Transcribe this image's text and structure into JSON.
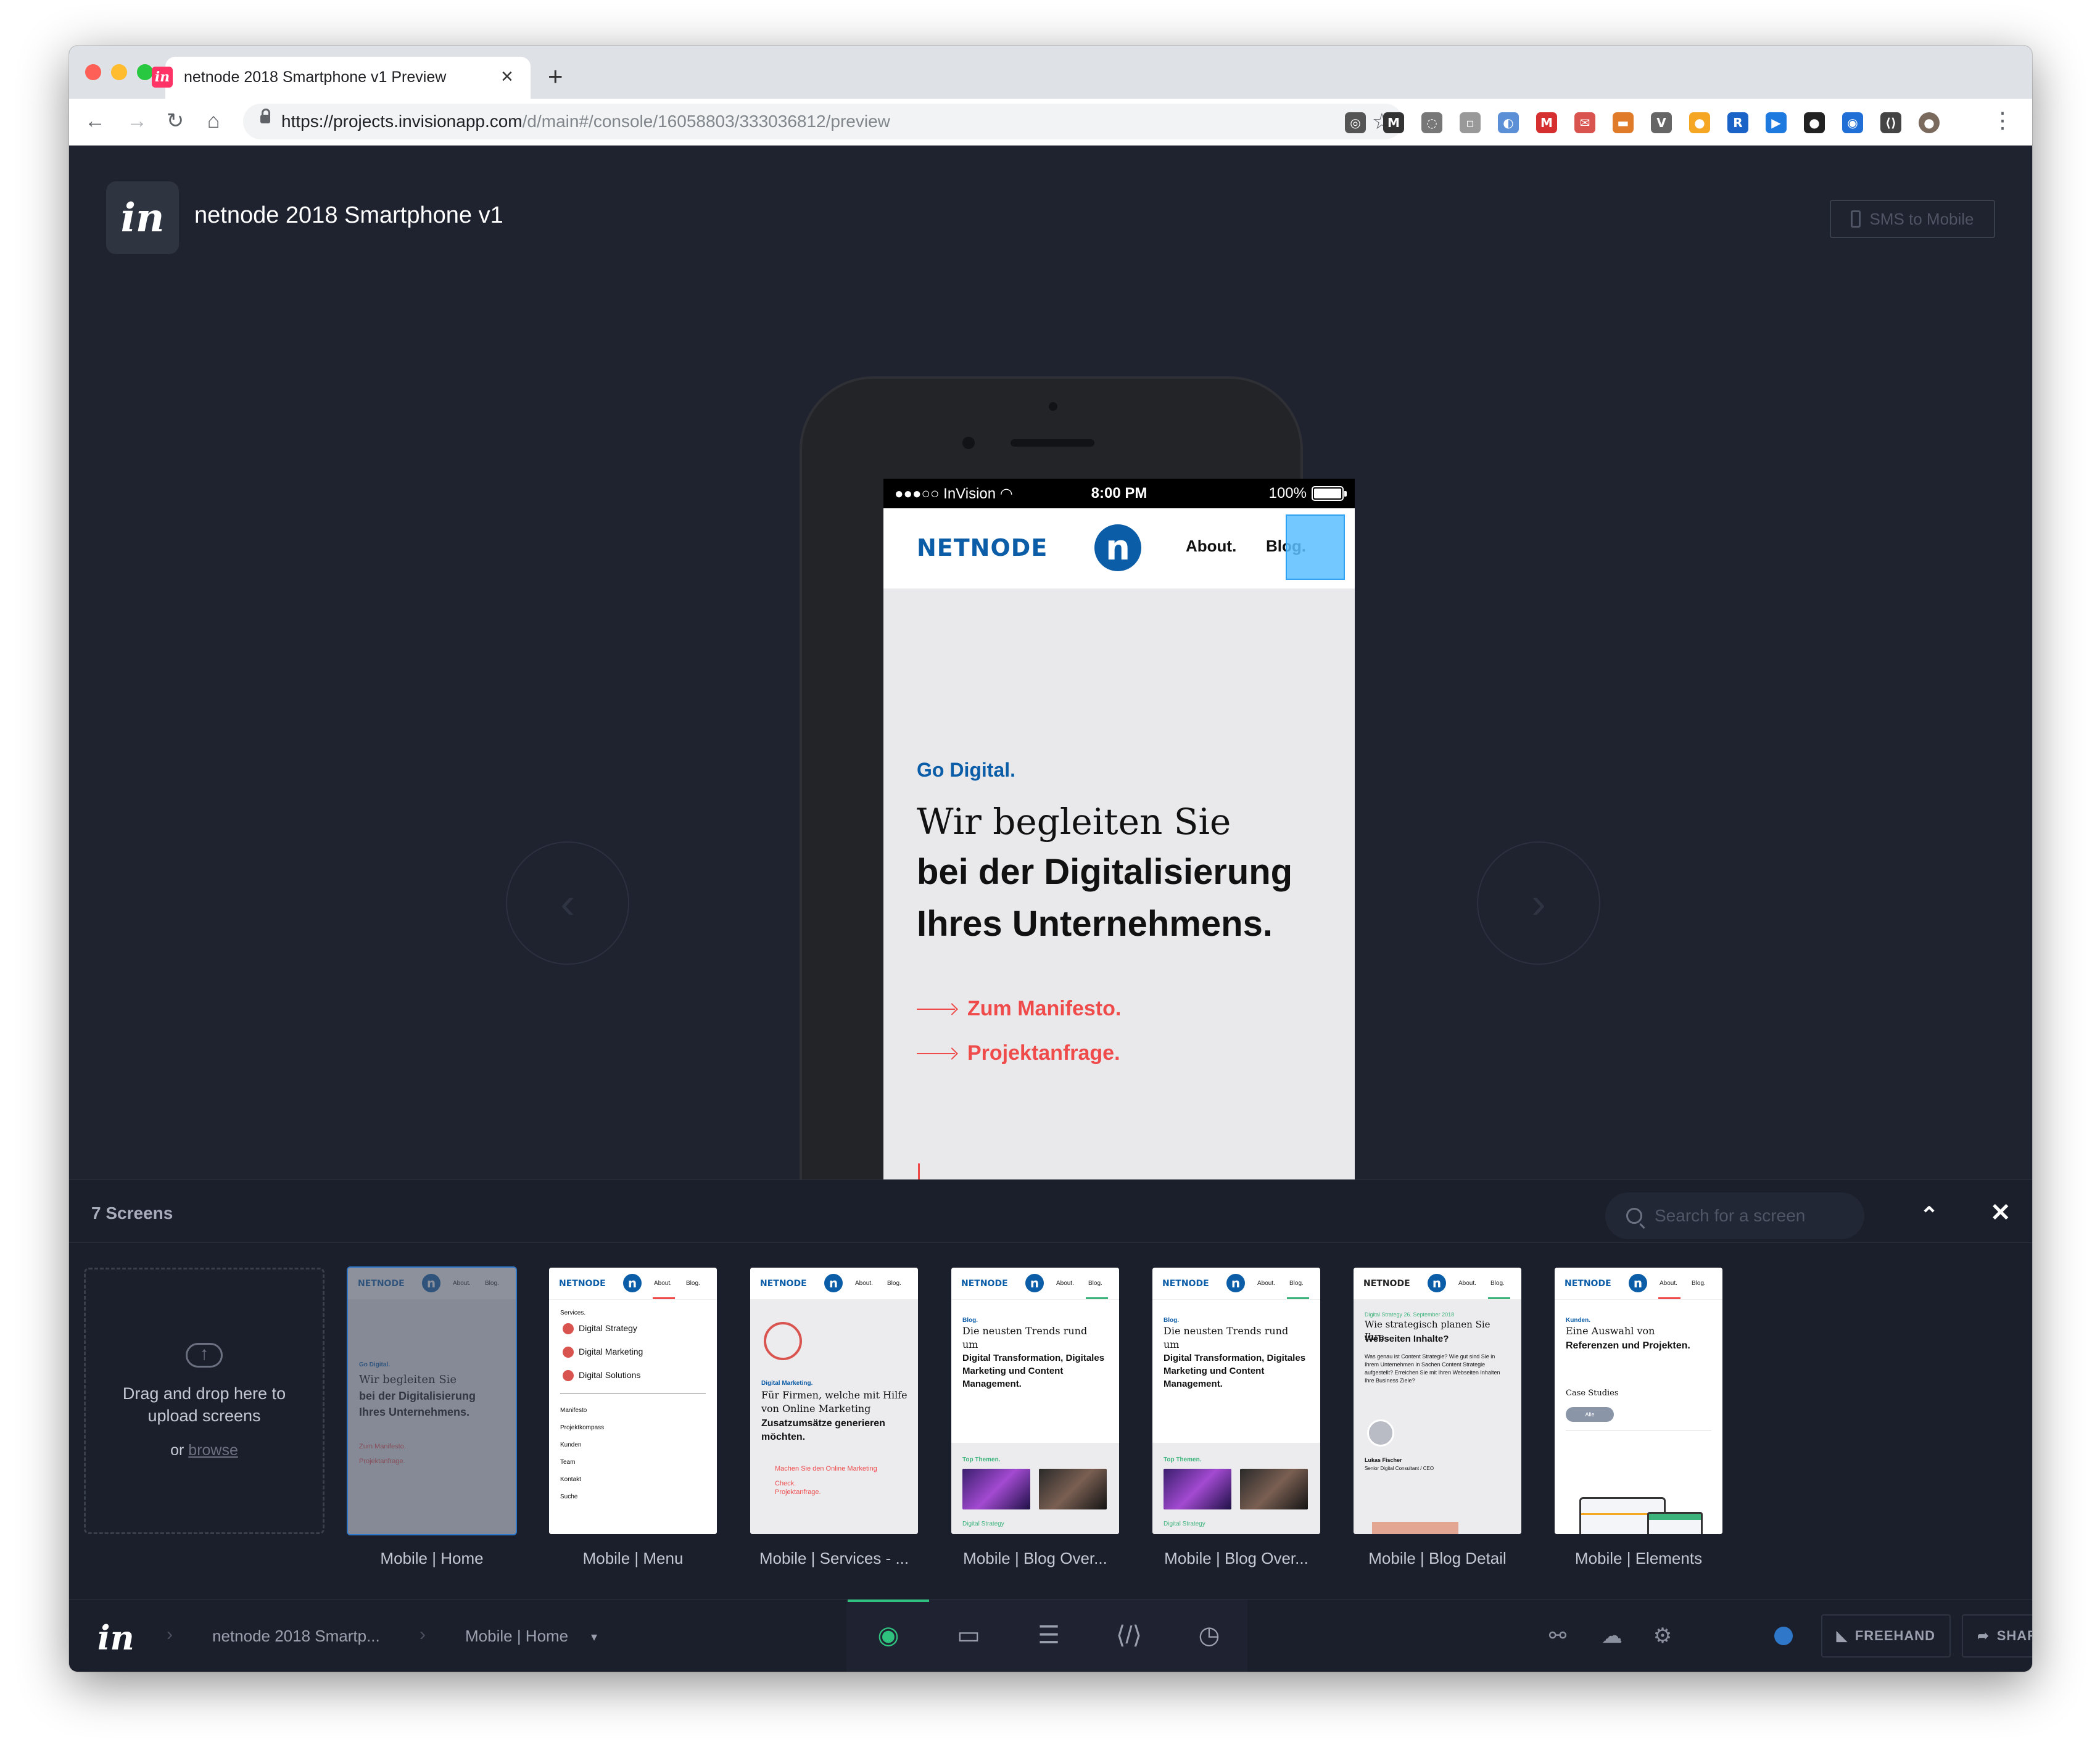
{
  "browser": {
    "tab_title": "netnode 2018 Smartphone v1 Preview",
    "tab_favicon": "in",
    "url_main": "https://projects.invisionapp.com",
    "url_path": "/d/main#/console/16058803/333036812/preview",
    "extensions": [
      {
        "icon": "lightbulb-ext-icon",
        "glyph": "◎",
        "color": "#555555"
      },
      {
        "icon": "m-ext-icon",
        "glyph": "M",
        "color": "#333333"
      },
      {
        "icon": "ring-ext-icon",
        "glyph": "◌",
        "color": "#777777"
      },
      {
        "icon": "page-ext-icon",
        "glyph": "▫",
        "color": "#999999"
      },
      {
        "icon": "circle-ext-icon",
        "glyph": "◐",
        "color": "#5b8fd6"
      },
      {
        "icon": "m-red-ext-icon",
        "glyph": "M",
        "color": "#d62f2f"
      },
      {
        "icon": "mail-ext-icon",
        "glyph": "✉",
        "color": "#d9534f"
      },
      {
        "icon": "orange-ext-icon",
        "glyph": "▬",
        "color": "#e07b2a"
      },
      {
        "icon": "v-ext-icon",
        "glyph": "V",
        "color": "#666666"
      },
      {
        "icon": "coin-ext-icon",
        "glyph": "●",
        "color": "#f5a623"
      },
      {
        "icon": "r-ext-icon",
        "glyph": "R",
        "color": "#1b63c6"
      },
      {
        "icon": "arrow-ext-icon",
        "glyph": "▶",
        "color": "#1f7ae0"
      },
      {
        "icon": "dark-circle-ext-icon",
        "glyph": "●",
        "color": "#222222"
      },
      {
        "icon": "blue-ring-ext-icon",
        "glyph": "◉",
        "color": "#1f6fd6"
      },
      {
        "icon": "code-ext-icon",
        "glyph": "⟨⟩",
        "color": "#444444"
      },
      {
        "icon": "avatar-ext-icon",
        "glyph": "●",
        "color": "#7a6a5e"
      }
    ]
  },
  "header": {
    "project_title": "netnode 2018 Smartphone v1",
    "sms_label": "SMS to Mobile"
  },
  "phone": {
    "status_left": "●●●○○ InVision ",
    "status_time": "8:00 PM",
    "status_battery": "100%",
    "site_logo": "NETNODE",
    "nav_about": "About.",
    "nav_blog": "Blog.",
    "kicker": "Go Digital.",
    "hero_line1": "Wir begleiten Sie",
    "hero_line2": "bei der Digitalisierung",
    "hero_line3": "Ihres Unternehmens.",
    "cta1": "Zum Manifesto.",
    "cta2": "Projektanfrage."
  },
  "panel": {
    "screens_count": "7 Screens",
    "search_placeholder": "Search for a screen",
    "dropzone_text": "Drag and drop here to upload screens",
    "dropzone_or": "or",
    "dropzone_browse": "browse",
    "screens": [
      {
        "label": "Mobile | Home",
        "active": true
      },
      {
        "label": "Mobile | Menu",
        "active": false
      },
      {
        "label": "Mobile | Services - ...",
        "active": false
      },
      {
        "label": "Mobile | Blog Over...",
        "active": false
      },
      {
        "label": "Mobile | Blog Over...",
        "active": false
      },
      {
        "label": "Mobile | Blog Detail",
        "active": false
      },
      {
        "label": "Mobile | Elements",
        "active": false
      }
    ],
    "thumbs": {
      "logo": "NETNODE",
      "about": "About.",
      "blog": "Blog.",
      "home_kicker": "Go Digital.",
      "home_l1": "Wir begleiten Sie",
      "home_l2": "bei der Digitalisierung",
      "home_l3": "Ihres Unternehmens.",
      "home_c1": "Zum Manifesto.",
      "home_c2": "Projektanfrage.",
      "menu_services": "Services.",
      "menu_items": [
        "Digital Strategy",
        "Digital Marketing",
        "Digital Solutions"
      ],
      "menu_links": [
        "Manifesto",
        "Projektkompass",
        "Kunden",
        "Team",
        "Kontakt",
        "Suche"
      ],
      "services_kicker": "Digital Marketing.",
      "services_text": "Für Firmen, welche mit Hilfe von Online Marketing",
      "services_bold": "Zusatzumsätze generieren möchten.",
      "services_cta1": "Machen Sie den Online Marketing Check.",
      "services_cta2": "Projektanfrage.",
      "blog_kicker": "Blog.",
      "blog_text": "Die neusten Trends rund um",
      "blog_bold": "Digital Transformation, Digitales Marketing und Content Management.",
      "blog_topics": "Top Themen.",
      "blog_tag": "Digital Strategy",
      "detail_meta": "Digital Strategy   26. September 2018",
      "detail_title": "Wie strategisch planen Sie Ihre",
      "detail_title_bold": "Webseiten Inhalte?",
      "detail_body": "Was genau ist Content Strategie? Wie gut sind Sie in Ihrem Unternehmen in Sachen Content Strategie aufgestellt? Erreichen Sie mit Ihren Webseiten Inhalten Ihre Business Ziele?",
      "detail_author": "Lukas Fischer",
      "detail_role": "Senior Digital Consultant / CEO",
      "el_kicker": "Kunden.",
      "el_text": "Eine Auswahl von",
      "el_bold": "Referenzen und Projekten.",
      "el_case": "Case Studies",
      "el_pill": "Alle"
    }
  },
  "bottombar": {
    "logo": "in",
    "crumb_project": "netnode 2018 Smartp...",
    "crumb_screen": "Mobile | Home",
    "freehand": "FREEHAND",
    "share": "SHARE"
  }
}
